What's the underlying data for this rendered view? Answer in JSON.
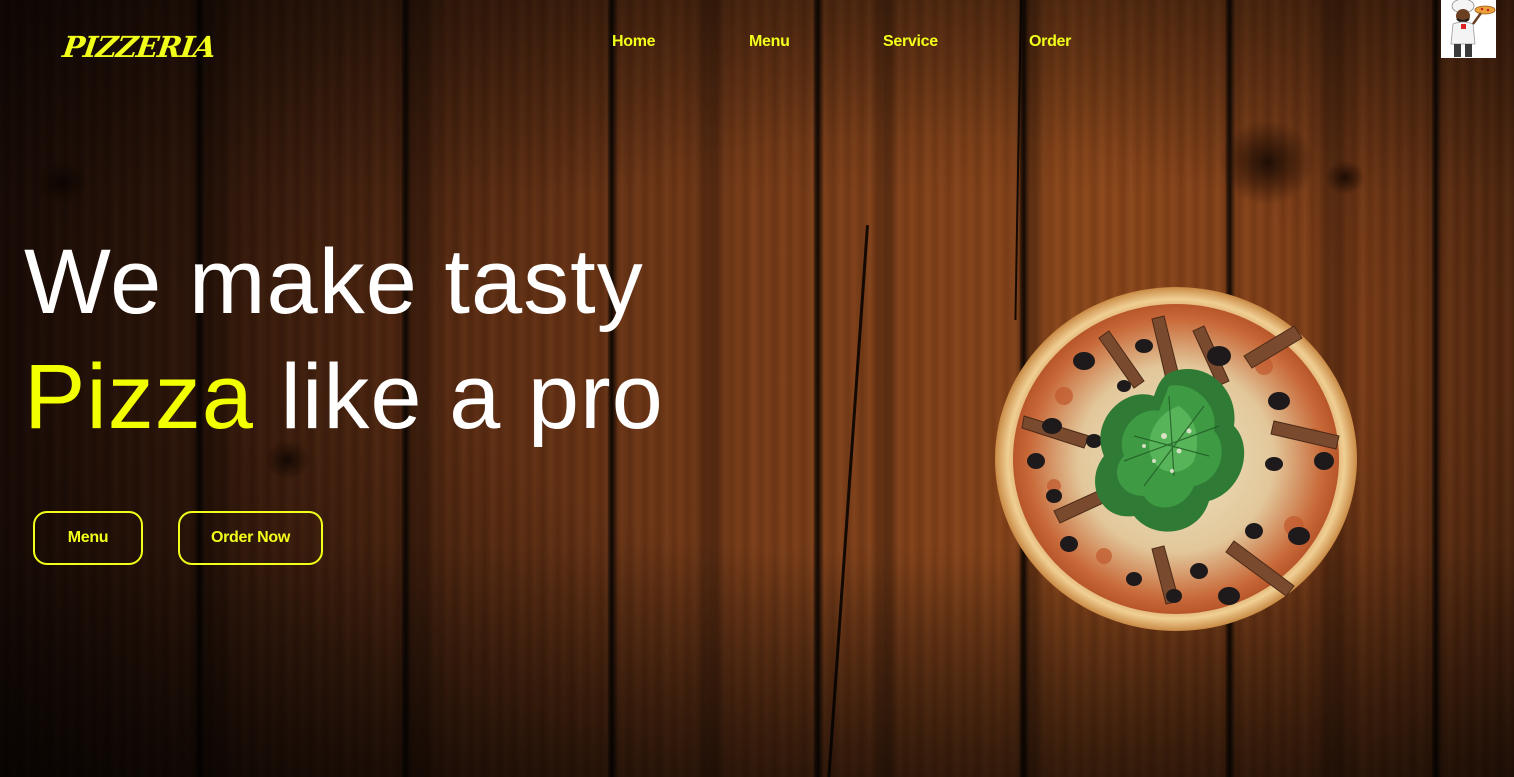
{
  "brand": {
    "logo_text": "PIZZERIA"
  },
  "nav": {
    "items": [
      {
        "label": "Home"
      },
      {
        "label": "Menu"
      },
      {
        "label": "Service"
      },
      {
        "label": "Order"
      }
    ]
  },
  "hero": {
    "line1": "We make tasty",
    "line2_accent": "Pizza",
    "line2_rest": " like a pro",
    "buttons": {
      "menu_label": "Menu",
      "order_label": "Order Now"
    }
  },
  "colors": {
    "accent": "#f2ff1a",
    "headline": "#ffffff",
    "wood": "#6b3314"
  },
  "icons": {
    "avatar": "chef-avatar-icon",
    "hero_image": "pizza-image"
  }
}
